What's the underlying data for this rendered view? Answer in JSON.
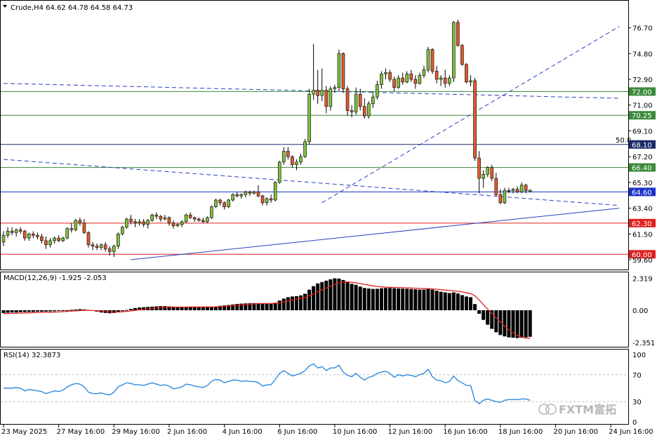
{
  "header": {
    "symbol_line": "Crude,H4  64.62 64.78 64.58 64.73",
    "macd_label": "MACD(12,26,9) -1.925 -2.053",
    "rsi_label": "RSI(14) 32.3873"
  },
  "watermark": "FXTM富拓",
  "colors": {
    "bull": "#7dc03d",
    "bear": "#e05a2c",
    "support_line": "#3a8a3a",
    "red_line": "#e02020",
    "current_price": "#1b32c8",
    "trend_line": "#2a3fbf",
    "macd_hist": "#000000",
    "macd_signal": "#e02020",
    "rsi_line": "#2f8be0"
  },
  "chart_data": [
    {
      "type": "candlestick",
      "title": "Crude,H4",
      "ohlc_header": {
        "open": 64.62,
        "high": 64.78,
        "low": 64.58,
        "close": 64.73
      },
      "ylim": [
        59.6,
        77.3
      ],
      "y_ticks": [
        "76.70",
        "74.80",
        "72.90",
        "71.00",
        "69.10",
        "67.20",
        "65.30",
        "63.40",
        "61.50",
        "59.60"
      ],
      "x_tick_labels": [
        "23 May 2025",
        "27 May 16:00",
        "29 May 16:00",
        "2 Jun 16:00",
        "4 Jun 16:00",
        "6 Jun 16:00",
        "10 Jun 16:00",
        "12 Jun 16:00",
        "16 Jun 16:00",
        "18 Jun 16:00",
        "20 Jun 16:00",
        "24 Jun 16:00"
      ],
      "x_tick_index": [
        0,
        13,
        26,
        39,
        52,
        65,
        78,
        91,
        104,
        117,
        130,
        143
      ],
      "candles": [
        [
          60.9,
          61.7,
          60.6,
          61.4
        ],
        [
          61.4,
          62.0,
          61.2,
          61.7
        ],
        [
          61.7,
          62.0,
          61.4,
          61.6
        ],
        [
          61.6,
          61.9,
          61.3,
          61.8
        ],
        [
          61.8,
          62.0,
          61.5,
          61.7
        ],
        [
          61.7,
          61.8,
          61.0,
          61.2
        ],
        [
          61.2,
          61.6,
          61.0,
          61.5
        ],
        [
          61.5,
          61.7,
          61.2,
          61.4
        ],
        [
          61.4,
          61.6,
          61.1,
          61.3
        ],
        [
          61.3,
          61.5,
          60.8,
          61.0
        ],
        [
          61.0,
          61.3,
          60.4,
          60.7
        ],
        [
          60.7,
          61.2,
          60.5,
          61.0
        ],
        [
          61.0,
          61.3,
          60.8,
          61.2
        ],
        [
          61.2,
          61.4,
          60.9,
          61.0
        ],
        [
          61.0,
          61.3,
          60.9,
          61.2
        ],
        [
          61.2,
          62.0,
          61.1,
          61.9
        ],
        [
          61.9,
          62.3,
          61.6,
          61.8
        ],
        [
          61.8,
          62.6,
          61.7,
          62.5
        ],
        [
          62.5,
          62.7,
          62.1,
          62.3
        ],
        [
          62.3,
          62.6,
          61.5,
          61.6
        ],
        [
          61.6,
          61.7,
          60.5,
          60.7
        ],
        [
          60.7,
          60.9,
          60.3,
          60.6
        ],
        [
          60.6,
          60.8,
          60.3,
          60.5
        ],
        [
          60.5,
          60.8,
          60.3,
          60.7
        ],
        [
          60.7,
          60.9,
          60.2,
          60.4
        ],
        [
          60.4,
          60.6,
          59.9,
          60.2
        ],
        [
          60.2,
          60.7,
          59.8,
          60.6
        ],
        [
          60.6,
          61.6,
          60.4,
          61.5
        ],
        [
          61.5,
          62.1,
          61.4,
          62.0
        ],
        [
          62.0,
          62.7,
          61.9,
          62.6
        ],
        [
          62.6,
          62.9,
          62.2,
          62.4
        ],
        [
          62.4,
          62.6,
          62.0,
          62.3
        ],
        [
          62.3,
          62.6,
          62.1,
          62.4
        ],
        [
          62.4,
          62.6,
          62.0,
          62.2
        ],
        [
          62.2,
          62.6,
          61.9,
          62.5
        ],
        [
          62.5,
          63.0,
          62.4,
          62.9
        ],
        [
          62.9,
          63.1,
          62.6,
          62.8
        ],
        [
          62.8,
          62.9,
          62.4,
          62.6
        ],
        [
          62.6,
          62.9,
          62.5,
          62.7
        ],
        [
          62.7,
          62.8,
          62.1,
          62.3
        ],
        [
          62.3,
          62.5,
          61.9,
          62.1
        ],
        [
          62.1,
          62.3,
          62.0,
          62.2
        ],
        [
          62.2,
          62.5,
          62.0,
          62.4
        ],
        [
          62.4,
          63.0,
          62.3,
          62.9
        ],
        [
          62.9,
          63.1,
          62.6,
          62.7
        ],
        [
          62.7,
          62.8,
          62.4,
          62.6
        ],
        [
          62.6,
          62.7,
          62.4,
          62.5
        ],
        [
          62.5,
          62.7,
          62.3,
          62.4
        ],
        [
          62.4,
          62.8,
          62.3,
          62.7
        ],
        [
          62.7,
          63.6,
          62.6,
          63.5
        ],
        [
          63.5,
          64.1,
          63.4,
          64.0
        ],
        [
          64.0,
          64.1,
          63.6,
          63.8
        ],
        [
          63.8,
          63.9,
          63.3,
          63.5
        ],
        [
          63.5,
          64.1,
          63.4,
          64.0
        ],
        [
          64.0,
          64.5,
          63.9,
          64.4
        ],
        [
          64.4,
          64.6,
          64.2,
          64.3
        ],
        [
          64.3,
          64.5,
          64.1,
          64.4
        ],
        [
          64.4,
          64.7,
          64.2,
          64.6
        ],
        [
          64.6,
          64.7,
          64.3,
          64.5
        ],
        [
          64.5,
          64.7,
          64.4,
          64.6
        ],
        [
          64.6,
          65.1,
          64.2,
          64.3
        ],
        [
          64.3,
          64.4,
          63.6,
          63.8
        ],
        [
          63.8,
          64.2,
          63.6,
          64.1
        ],
        [
          64.1,
          64.4,
          63.8,
          64.0
        ],
        [
          64.0,
          65.4,
          63.9,
          65.3
        ],
        [
          65.3,
          66.9,
          65.2,
          66.8
        ],
        [
          66.8,
          67.9,
          66.6,
          67.6
        ],
        [
          67.6,
          67.9,
          67.0,
          67.2
        ],
        [
          67.2,
          67.3,
          66.4,
          66.6
        ],
        [
          66.6,
          67.0,
          66.2,
          66.8
        ],
        [
          66.8,
          67.4,
          66.6,
          67.2
        ],
        [
          67.2,
          68.5,
          67.1,
          68.3
        ],
        [
          68.3,
          72.2,
          68.1,
          71.8
        ],
        [
          71.8,
          75.5,
          71.4,
          72.1
        ],
        [
          72.1,
          73.6,
          71.1,
          71.7
        ],
        [
          71.7,
          73.7,
          71.3,
          72.1
        ],
        [
          72.1,
          72.4,
          70.4,
          70.9
        ],
        [
          70.9,
          72.4,
          70.6,
          72.2
        ],
        [
          72.2,
          72.5,
          71.9,
          72.3
        ],
        [
          72.3,
          75.1,
          72.0,
          74.8
        ],
        [
          74.8,
          74.9,
          71.9,
          72.2
        ],
        [
          72.2,
          72.4,
          70.2,
          70.6
        ],
        [
          70.6,
          71.0,
          70.1,
          70.5
        ],
        [
          70.5,
          72.3,
          70.3,
          71.8
        ],
        [
          71.8,
          72.2,
          70.6,
          70.9
        ],
        [
          70.9,
          71.5,
          70.0,
          70.2
        ],
        [
          70.2,
          71.3,
          70.0,
          71.1
        ],
        [
          71.1,
          72.0,
          70.8,
          71.6
        ],
        [
          71.6,
          72.8,
          71.4,
          72.5
        ],
        [
          72.5,
          73.5,
          72.2,
          73.3
        ],
        [
          73.3,
          73.7,
          72.9,
          73.4
        ],
        [
          73.4,
          73.6,
          72.7,
          72.9
        ],
        [
          72.9,
          73.1,
          72.0,
          72.3
        ],
        [
          72.3,
          73.2,
          72.2,
          73.0
        ],
        [
          73.0,
          73.4,
          72.5,
          72.7
        ],
        [
          72.7,
          73.5,
          72.6,
          73.3
        ],
        [
          73.3,
          73.6,
          72.7,
          72.9
        ],
        [
          72.9,
          73.2,
          72.2,
          72.6
        ],
        [
          72.6,
          73.4,
          72.5,
          73.2
        ],
        [
          73.2,
          73.9,
          73.0,
          73.6
        ],
        [
          73.6,
          75.3,
          73.4,
          75.1
        ],
        [
          75.1,
          75.2,
          73.3,
          73.5
        ],
        [
          73.5,
          73.9,
          72.6,
          72.9
        ],
        [
          72.9,
          73.2,
          72.4,
          73.0
        ],
        [
          73.0,
          73.6,
          72.3,
          72.6
        ],
        [
          72.6,
          73.2,
          72.4,
          73.0
        ],
        [
          73.0,
          77.2,
          72.7,
          77.1
        ],
        [
          77.1,
          77.3,
          75.3,
          75.4
        ],
        [
          75.4,
          75.5,
          73.9,
          74.0
        ],
        [
          74.0,
          74.1,
          72.6,
          72.7
        ],
        [
          72.7,
          73.2,
          72.4,
          72.8
        ],
        [
          72.8,
          73.0,
          66.9,
          67.1
        ],
        [
          67.1,
          67.6,
          64.5,
          65.6
        ],
        [
          65.6,
          66.2,
          64.9,
          65.9
        ],
        [
          65.9,
          66.5,
          65.7,
          66.4
        ],
        [
          66.4,
          66.6,
          65.4,
          65.6
        ],
        [
          65.6,
          66.0,
          64.3,
          64.4
        ],
        [
          64.4,
          64.8,
          63.7,
          63.8
        ],
        [
          63.8,
          64.9,
          63.7,
          64.7
        ],
        [
          64.7,
          64.9,
          64.5,
          64.7
        ],
        [
          64.7,
          64.9,
          64.5,
          64.8
        ],
        [
          64.8,
          65.0,
          64.5,
          64.6
        ],
        [
          64.6,
          65.3,
          64.5,
          65.1
        ],
        [
          65.1,
          65.2,
          64.5,
          64.7
        ],
        [
          64.62,
          64.78,
          64.58,
          64.73
        ]
      ],
      "horizontal_levels": [
        {
          "value": 72.0,
          "label": "72.00",
          "color": "#3a8a3a"
        },
        {
          "value": 70.25,
          "label": "70.25",
          "color": "#3a8a3a"
        },
        {
          "value": 68.1,
          "label": "68.10",
          "color": "#1a2b6b",
          "note": "50.0"
        },
        {
          "value": 66.4,
          "label": "66.40",
          "color": "#3a8a3a"
        },
        {
          "value": 64.6,
          "label": "64.60",
          "color": "#1b32c8"
        },
        {
          "value": 62.3,
          "label": "62.30",
          "color": "#e02020"
        },
        {
          "value": 60.0,
          "label": "60.00",
          "color": "#e02020"
        }
      ],
      "trend_lines": [
        {
          "from": [
            0,
            72.6
          ],
          "to": [
            145,
            71.5
          ],
          "style": "dashed"
        },
        {
          "from": [
            0,
            67.0
          ],
          "to": [
            145,
            63.6
          ],
          "style": "dashed"
        },
        {
          "from": [
            75,
            63.8
          ],
          "to": [
            145,
            76.8
          ],
          "style": "dashed"
        },
        {
          "from": [
            30,
            59.6
          ],
          "to": [
            145,
            63.4
          ],
          "style": "solid"
        }
      ]
    },
    {
      "type": "bar",
      "title": "MACD(12,26,9) -1.925 -2.053",
      "ylim": [
        -2.5,
        2.45
      ],
      "y_ticks": [
        "2.319",
        "0.00",
        "-2.351"
      ],
      "histogram": [
        -0.2,
        -0.18,
        -0.16,
        -0.16,
        -0.14,
        -0.13,
        -0.12,
        -0.12,
        -0.1,
        -0.1,
        -0.09,
        -0.08,
        -0.07,
        -0.05,
        -0.02,
        0.0,
        0.03,
        0.05,
        0.08,
        0.06,
        0.02,
        -0.04,
        -0.1,
        -0.16,
        -0.2,
        -0.22,
        -0.2,
        -0.14,
        -0.06,
        0.02,
        0.1,
        0.16,
        0.2,
        0.22,
        0.24,
        0.26,
        0.28,
        0.3,
        0.3,
        0.28,
        0.26,
        0.24,
        0.24,
        0.25,
        0.26,
        0.26,
        0.24,
        0.22,
        0.22,
        0.24,
        0.28,
        0.32,
        0.35,
        0.38,
        0.42,
        0.46,
        0.48,
        0.5,
        0.51,
        0.52,
        0.52,
        0.5,
        0.48,
        0.48,
        0.55,
        0.7,
        0.85,
        0.95,
        1.0,
        1.02,
        1.08,
        1.2,
        1.5,
        1.75,
        1.95,
        2.05,
        2.15,
        2.25,
        2.32,
        2.3,
        2.2,
        2.05,
        1.92,
        1.85,
        1.72,
        1.62,
        1.58,
        1.55,
        1.56,
        1.6,
        1.62,
        1.62,
        1.6,
        1.58,
        1.57,
        1.56,
        1.54,
        1.52,
        1.5,
        1.5,
        1.55,
        1.5,
        1.42,
        1.35,
        1.3,
        1.25,
        1.3,
        1.22,
        1.1,
        1.0,
        0.95,
        0.45,
        -0.25,
        -0.7,
        -1.05,
        -1.35,
        -1.6,
        -1.8,
        -1.9,
        -1.97,
        -2.0,
        -2.02,
        -2.0,
        -1.97,
        -1.93
      ],
      "signal": [
        -0.25,
        -0.24,
        -0.23,
        -0.22,
        -0.21,
        -0.2,
        -0.19,
        -0.18,
        -0.17,
        -0.16,
        -0.15,
        -0.14,
        -0.13,
        -0.12,
        -0.1,
        -0.08,
        -0.06,
        -0.04,
        -0.02,
        -0.01,
        -0.01,
        -0.02,
        -0.04,
        -0.07,
        -0.1,
        -0.12,
        -0.13,
        -0.13,
        -0.11,
        -0.08,
        -0.05,
        -0.01,
        0.03,
        0.07,
        0.1,
        0.13,
        0.16,
        0.19,
        0.21,
        0.22,
        0.23,
        0.23,
        0.23,
        0.23,
        0.24,
        0.24,
        0.24,
        0.24,
        0.24,
        0.24,
        0.25,
        0.26,
        0.28,
        0.3,
        0.33,
        0.36,
        0.39,
        0.42,
        0.44,
        0.46,
        0.48,
        0.49,
        0.49,
        0.49,
        0.5,
        0.54,
        0.6,
        0.67,
        0.74,
        0.8,
        0.86,
        0.93,
        1.05,
        1.18,
        1.33,
        1.48,
        1.62,
        1.75,
        1.88,
        1.98,
        2.05,
        2.06,
        2.03,
        1.99,
        1.94,
        1.88,
        1.83,
        1.77,
        1.73,
        1.7,
        1.68,
        1.67,
        1.66,
        1.65,
        1.64,
        1.63,
        1.62,
        1.6,
        1.59,
        1.57,
        1.57,
        1.55,
        1.53,
        1.5,
        1.47,
        1.43,
        1.41,
        1.38,
        1.33,
        1.27,
        1.21,
        1.05,
        0.75,
        0.42,
        0.08,
        -0.25,
        -0.55,
        -0.85,
        -1.15,
        -1.42,
        -1.65,
        -1.83,
        -1.95,
        -2.02,
        -2.05
      ]
    },
    {
      "type": "line",
      "title": "RSI(14) 32.3873",
      "ylim": [
        0,
        100
      ],
      "y_ticks": [
        "100",
        "70",
        "30",
        "0"
      ],
      "levels": [
        70,
        30
      ],
      "values": [
        50,
        50,
        50,
        51,
        50,
        46,
        48,
        47,
        46,
        45,
        42,
        44,
        46,
        45,
        47,
        52,
        55,
        57,
        56,
        52,
        44,
        42,
        42,
        43,
        41,
        40,
        44,
        52,
        55,
        58,
        57,
        55,
        55,
        54,
        56,
        58,
        56,
        54,
        55,
        53,
        49,
        50,
        52,
        56,
        55,
        53,
        52,
        51,
        54,
        60,
        63,
        62,
        58,
        60,
        62,
        62,
        60,
        61,
        60,
        60,
        58,
        53,
        55,
        55,
        63,
        72,
        76,
        72,
        68,
        70,
        72,
        76,
        83,
        86,
        80,
        82,
        76,
        80,
        80,
        84,
        74,
        69,
        67,
        72,
        66,
        62,
        66,
        68,
        72,
        74,
        75,
        72,
        66,
        70,
        68,
        70,
        69,
        67,
        70,
        72,
        78,
        67,
        62,
        61,
        58,
        60,
        68,
        61,
        58,
        54,
        54,
        32,
        27,
        32,
        34,
        32,
        30,
        29,
        32,
        33,
        33,
        33,
        34,
        34,
        32
      ]
    }
  ]
}
